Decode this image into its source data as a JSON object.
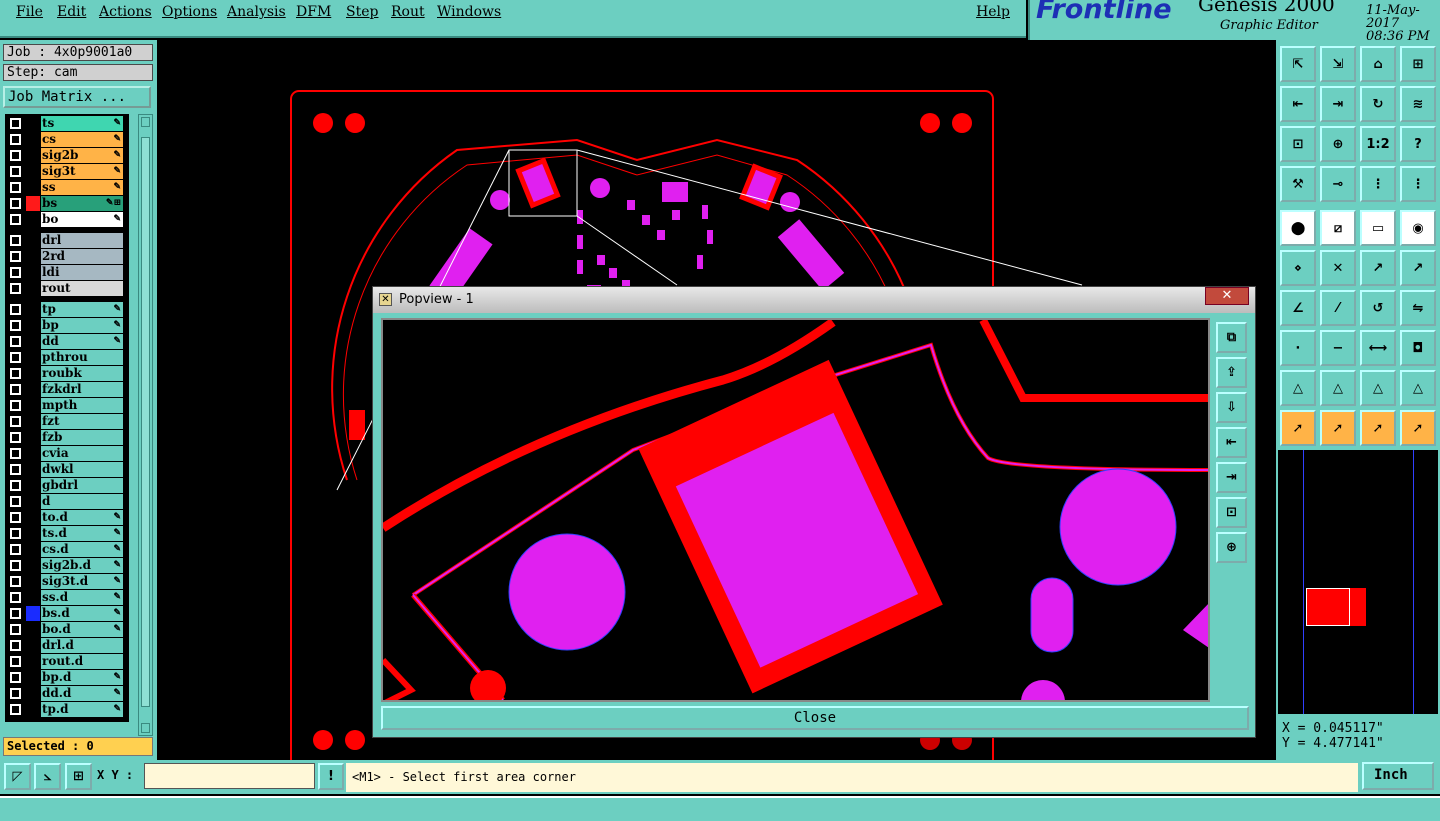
{
  "menu": {
    "items": [
      "File",
      "Edit",
      "Actions",
      "Options",
      "Analysis",
      "DFM",
      "Step",
      "Rout",
      "Windows"
    ],
    "help": "Help"
  },
  "brand": {
    "logo": "Frontline",
    "app": "Genesis 2000",
    "subtitle": "Graphic Editor",
    "date": "11-May-2017",
    "time": "08:36 PM"
  },
  "job": {
    "label": "Job : 4x0p9001a0",
    "step": "Step: cam",
    "matrix_button": "Job Matrix ..."
  },
  "layers": [
    {
      "name": "ts",
      "bg": "#3fd6b0",
      "color": "",
      "flag": "✎"
    },
    {
      "name": "cs",
      "bg": "#ffb347",
      "color": "",
      "flag": "✎"
    },
    {
      "name": "sig2b",
      "bg": "#ffb347",
      "color": "",
      "flag": "✎"
    },
    {
      "name": "sig3t",
      "bg": "#ffb347",
      "color": "",
      "flag": "✎"
    },
    {
      "name": "ss",
      "bg": "#ffb347",
      "color": "",
      "flag": "✎"
    },
    {
      "name": "bs",
      "bg": "#28a07a",
      "color": "#ff1a1a",
      "flag": "✎⊞"
    },
    {
      "name": "bo",
      "bg": "#ffffff",
      "color": "",
      "flag": "✎"
    },
    {
      "name": "drl",
      "bg": "#a6b8c2",
      "color": "",
      "flag": ""
    },
    {
      "name": "2rd",
      "bg": "#a6b8c2",
      "color": "",
      "flag": ""
    },
    {
      "name": "ldi",
      "bg": "#a6b8c2",
      "color": "",
      "flag": ""
    },
    {
      "name": "rout",
      "bg": "#d8d8d8",
      "color": "",
      "flag": ""
    },
    {
      "name": "tp",
      "bg": "#6ccfc1",
      "color": "",
      "flag": "✎"
    },
    {
      "name": "bp",
      "bg": "#6ccfc1",
      "color": "",
      "flag": "✎"
    },
    {
      "name": "dd",
      "bg": "#6ccfc1",
      "color": "",
      "flag": "✎"
    },
    {
      "name": "pthrou",
      "bg": "#6ccfc1",
      "color": "",
      "flag": ""
    },
    {
      "name": "roubk",
      "bg": "#6ccfc1",
      "color": "",
      "flag": ""
    },
    {
      "name": "fzkdrl",
      "bg": "#6ccfc1",
      "color": "",
      "flag": ""
    },
    {
      "name": "mpth",
      "bg": "#6ccfc1",
      "color": "",
      "flag": ""
    },
    {
      "name": "fzt",
      "bg": "#6ccfc1",
      "color": "",
      "flag": ""
    },
    {
      "name": "fzb",
      "bg": "#6ccfc1",
      "color": "",
      "flag": ""
    },
    {
      "name": "cvia",
      "bg": "#6ccfc1",
      "color": "",
      "flag": ""
    },
    {
      "name": "dwkl",
      "bg": "#6ccfc1",
      "color": "",
      "flag": ""
    },
    {
      "name": "gbdrl",
      "bg": "#6ccfc1",
      "color": "",
      "flag": ""
    },
    {
      "name": "d",
      "bg": "#6ccfc1",
      "color": "",
      "flag": ""
    },
    {
      "name": "to.d",
      "bg": "#6ccfc1",
      "color": "",
      "flag": "✎"
    },
    {
      "name": "ts.d",
      "bg": "#6ccfc1",
      "color": "",
      "flag": "✎"
    },
    {
      "name": "cs.d",
      "bg": "#6ccfc1",
      "color": "",
      "flag": "✎"
    },
    {
      "name": "sig2b.d",
      "bg": "#6ccfc1",
      "color": "",
      "flag": "✎"
    },
    {
      "name": "sig3t.d",
      "bg": "#6ccfc1",
      "color": "",
      "flag": "✎"
    },
    {
      "name": "ss.d",
      "bg": "#6ccfc1",
      "color": "",
      "flag": "✎"
    },
    {
      "name": "bs.d",
      "bg": "#6ccfc1",
      "color": "#1a2cff",
      "flag": "✎"
    },
    {
      "name": "bo.d",
      "bg": "#6ccfc1",
      "color": "",
      "flag": "✎"
    },
    {
      "name": "drl.d",
      "bg": "#6ccfc1",
      "color": "",
      "flag": ""
    },
    {
      "name": "rout.d",
      "bg": "#6ccfc1",
      "color": "",
      "flag": ""
    },
    {
      "name": "bp.d",
      "bg": "#6ccfc1",
      "color": "",
      "flag": "✎"
    },
    {
      "name": "dd.d",
      "bg": "#6ccfc1",
      "color": "",
      "flag": "✎"
    },
    {
      "name": "tp.d",
      "bg": "#6ccfc1",
      "color": "",
      "flag": "✎"
    }
  ],
  "selected": "Selected : 0",
  "tools": [
    "home-icon",
    "export-icon",
    "house-icon",
    "grid-icon",
    "pan-left-icon",
    "pan-right-icon",
    "zoom-icon",
    "redraw-icon",
    "fit-icon",
    "center-icon",
    "scale-icon",
    "help-icon",
    "measure-icon",
    "probe-icon",
    "net-icon",
    "net2-icon",
    "select-icon",
    "line-icon",
    "ruler-icon",
    "circle-icon",
    "connect-icon",
    "cross-icon",
    "arc-icon",
    "arc2-icon",
    "angle-icon",
    "slash-icon",
    "rotate-icon",
    "mirror-icon",
    "dot-icon",
    "minus-icon",
    "arrows-icon",
    "shapes-icon",
    "triangle-icon",
    "triangle2-icon",
    "triangle3-icon",
    "triangle4-icon",
    "pointer-icon",
    "pointer2-icon",
    "pointer3-icon",
    "pointer4-icon"
  ],
  "tool_text": {
    "scale": "1:2",
    "help": "?"
  },
  "coords": {
    "x": "X = 0.045117\"",
    "y": "Y = 4.477141\""
  },
  "bottom": {
    "xy_label": "X Y :",
    "xy_value": "",
    "message": "<M1> - Select first area corner",
    "unit": "Inch",
    "excl": "!"
  },
  "popup": {
    "title": "Popview - 1",
    "close_x": "✕",
    "close_button": "Close"
  },
  "colors": {
    "accent": "#6ccfc1",
    "copper": "#ff0000",
    "pad": "#e020f0"
  }
}
